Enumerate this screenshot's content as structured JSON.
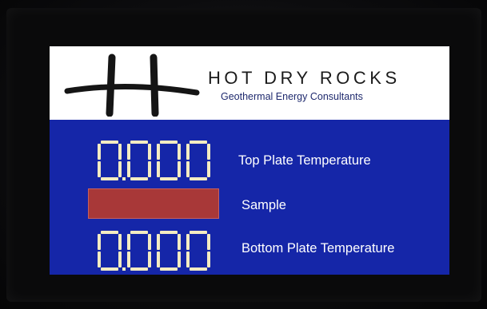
{
  "brand": {
    "title": "HOT DRY ROCKS",
    "subtitle": "Geothermal Energy Consultants",
    "logo_icon": "hdr-logo-icon"
  },
  "readings": {
    "top_plate": {
      "value": "0.000",
      "label": "Top Plate Temperature"
    },
    "sample": {
      "label": "Sample",
      "indicator_color": "#a83838"
    },
    "bottom_plate": {
      "value": "0.000",
      "label": "Bottom Plate Temperature"
    }
  },
  "colors": {
    "panel_background": "#1526a8",
    "header_background": "#ffffff",
    "segment_color": "#f4ecc2"
  }
}
